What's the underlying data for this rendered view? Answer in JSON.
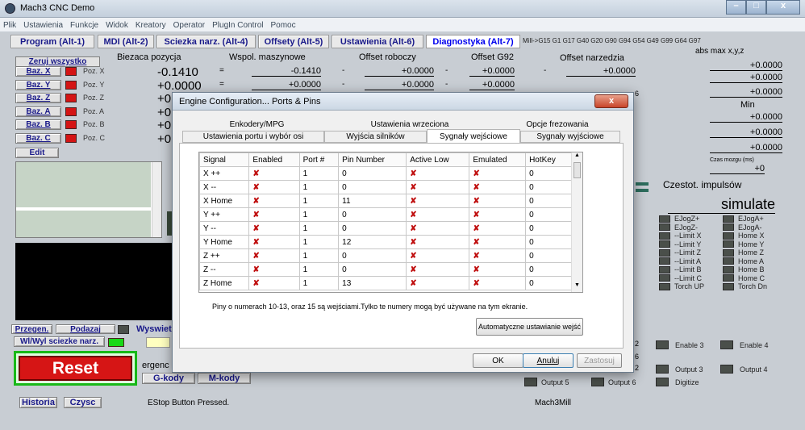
{
  "window": {
    "title": "Mach3 CNC Demo"
  },
  "menu": [
    "Plik",
    "Ustawienia",
    "Funkcje",
    "Widok",
    "Kreatory",
    "Operator",
    "PlugIn Control",
    "Pomoc"
  ],
  "tabs": [
    {
      "label": "Program (Alt-1)"
    },
    {
      "label": "MDI (Alt-2)"
    },
    {
      "label": "Sciezka narz. (Alt-4)"
    },
    {
      "label": "Offsety (Alt-5)"
    },
    {
      "label": "Ustawienia (Alt-6)"
    },
    {
      "label": "Diagnostyka (Alt-7)",
      "active": true
    }
  ],
  "gcode_status": "Mill->G15  G1 G17 G40 G20 G90 G94 G54 G49 G99 G64 G97",
  "headers": {
    "biezaca": "Biezaca pozycja",
    "wspol": "Wspol. maszynowe",
    "roboczy": "Offset roboczy",
    "g92": "Offset G92",
    "narzedzia": "Offset narzedzia",
    "absmax": "abs max x,y,z",
    "min": "Min",
    "czas": "Czas mozgu (ms)",
    "czestot": "Czestot. impulsów"
  },
  "zero_all": "Zeruj wszystko",
  "axes": [
    {
      "btn": "Baz. X",
      "poz": "Poz. X",
      "cur": "-0.1410",
      "mach": "-0.1410",
      "work": "+0.0000",
      "g92": "+0.0000",
      "tool": "+0.0000"
    },
    {
      "btn": "Baz. Y",
      "poz": "Poz. Y",
      "cur": "+0.0000",
      "mach": "+0.0000",
      "work": "+0.0000",
      "g92": "+0.0000"
    },
    {
      "btn": "Baz. Z",
      "poz": "Poz. Z",
      "cur": "+0"
    },
    {
      "btn": "Baz. A",
      "poz": "Poz. A",
      "cur": "+0"
    },
    {
      "btn": "Baz. B",
      "poz": "Poz. B",
      "cur": "+0."
    },
    {
      "btn": "Baz. C",
      "poz": "Poz. C",
      "cur": "+0"
    }
  ],
  "eq": "=",
  "dash": "-",
  "absmax_vals": [
    "+0.0000",
    "+0.0000",
    "+0.0000"
  ],
  "min_vals": [
    "+0.0000",
    "+0.0000",
    "+0.0000"
  ],
  "czas_val": "+0",
  "simulate": "simulate",
  "edit": "Edit",
  "lower": {
    "przegen": "Przegen.",
    "podazaj": "Podazaj",
    "wyswiet": "Wyswiet",
    "wl": "Wl/Wyl sciezke narz.",
    "reset": "Reset",
    "ergenc": "ergenc",
    "gkody": "G-kody",
    "mkody": "M-kody",
    "historia": "Historia",
    "czysc": "Czysc",
    "status": "EStop Button Pressed.",
    "profile": "Mach3Mill"
  },
  "right_signals": [
    [
      "EJogZ+",
      "EJogA+"
    ],
    [
      "EJogZ-",
      "EJogA-"
    ],
    [
      "--Limit X",
      "Home X"
    ],
    [
      "--Limit Y",
      "Home Y"
    ],
    [
      "--Limit Z",
      "Home Z"
    ],
    [
      "--Limit A",
      "Home A"
    ],
    [
      "--Limit B",
      "Home B"
    ],
    [
      "--Limit C",
      "Home C"
    ],
    [
      "Torch UP",
      "Torch Dn"
    ]
  ],
  "enables": [
    "Enable 3",
    "Enable 4"
  ],
  "outputs_right": [
    "Output 3",
    "Output 4"
  ],
  "outputs_bottom": [
    "Output 5",
    "Output 6",
    "Digitize"
  ],
  "partial_nums": [
    "2",
    "6",
    "2",
    "6"
  ],
  "dialog": {
    "title": "Engine Configuration... Ports & Pins",
    "tabs_row1": [
      "Enkodery/MPG",
      "Ustawienia wrzeciona",
      "Opcje frezowania"
    ],
    "tabs_row2": [
      "Ustawienia portu i wybór osi",
      "Wyjścia silników",
      "Sygnały wejściowe",
      "Sygnały wyjściowe"
    ],
    "columns": [
      "Signal",
      "Enabled",
      "Port #",
      "Pin Number",
      "Active Low",
      "Emulated",
      "HotKey"
    ],
    "rows": [
      [
        "X ++",
        "1",
        "0",
        "0"
      ],
      [
        "X --",
        "1",
        "0",
        "0"
      ],
      [
        "X Home",
        "1",
        "11",
        "0"
      ],
      [
        "Y ++",
        "1",
        "0",
        "0"
      ],
      [
        "Y --",
        "1",
        "0",
        "0"
      ],
      [
        "Y Home",
        "1",
        "12",
        "0"
      ],
      [
        "Z ++",
        "1",
        "0",
        "0"
      ],
      [
        "Z --",
        "1",
        "0",
        "0"
      ],
      [
        "Z Home",
        "1",
        "13",
        "0"
      ]
    ],
    "note": "Piny o numerach 10-13, oraz 15 są wejściami.Tylko te numery mogą być używane na tym ekranie.",
    "auto_btn": "Automatyczne ustawianie wejść",
    "ok": "OK",
    "cancel": "Anuluj",
    "apply": "Zastosuj",
    "close": "x"
  }
}
